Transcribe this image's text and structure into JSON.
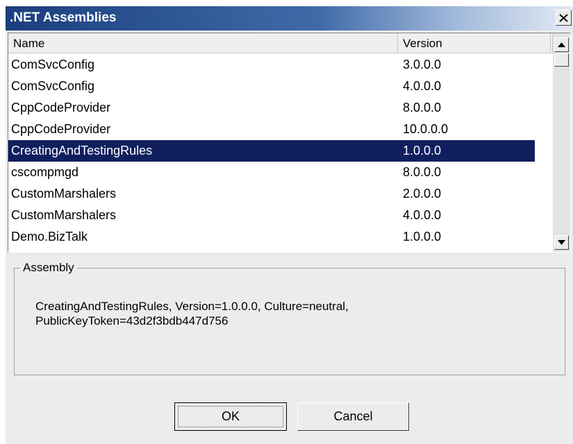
{
  "window": {
    "title": ".NET Assemblies",
    "close_icon": "close-icon"
  },
  "list": {
    "columns": {
      "name": "Name",
      "version": "Version"
    },
    "rows": [
      {
        "name": "ComSvcConfig",
        "version": "3.0.0.0"
      },
      {
        "name": "ComSvcConfig",
        "version": "4.0.0.0"
      },
      {
        "name": "CppCodeProvider",
        "version": "8.0.0.0"
      },
      {
        "name": "CppCodeProvider",
        "version": "10.0.0.0"
      },
      {
        "name": "CreatingAndTestingRules",
        "version": "1.0.0.0",
        "selected": true
      },
      {
        "name": "cscompmgd",
        "version": "8.0.0.0"
      },
      {
        "name": "CustomMarshalers",
        "version": "2.0.0.0"
      },
      {
        "name": "CustomMarshalers",
        "version": "4.0.0.0"
      },
      {
        "name": "Demo.BizTalk",
        "version": "1.0.0.0"
      }
    ],
    "scroll_icons": {
      "up": "scroll-up-arrow-icon",
      "down": "scroll-down-arrow-icon"
    }
  },
  "assembly_group": {
    "legend": "Assembly",
    "line1": "CreatingAndTestingRules, Version=1.0.0.0, Culture=neutral,",
    "line2": "PublicKeyToken=43d2f3bdb447d756"
  },
  "buttons": {
    "ok": "OK",
    "cancel": "Cancel"
  },
  "colors": {
    "selection": "#0f1f5e",
    "title_bar_start": "#1b3f7e",
    "dialog_background": "#ececec"
  }
}
